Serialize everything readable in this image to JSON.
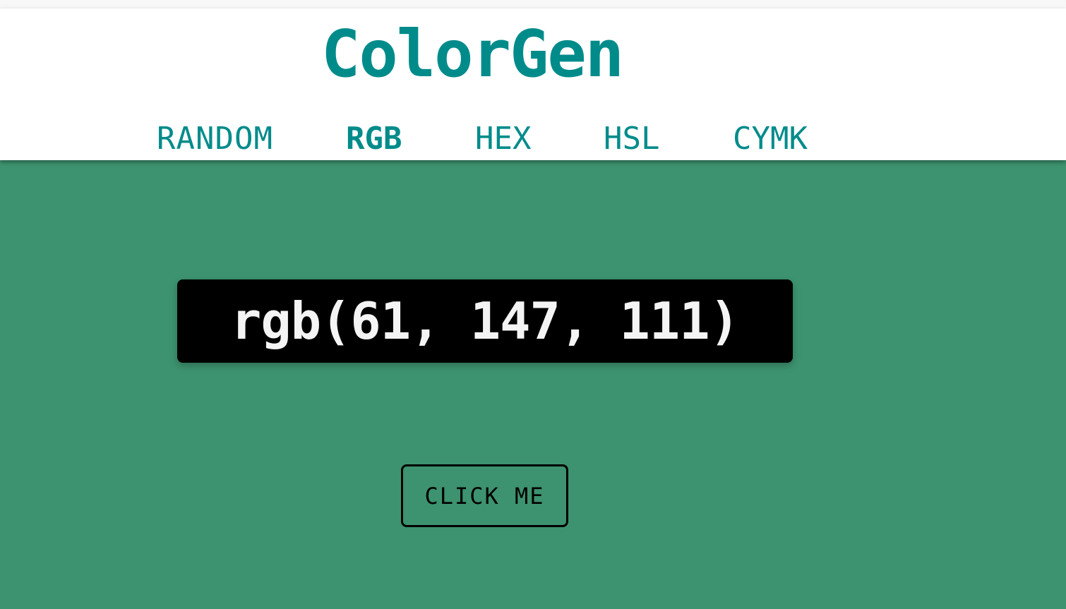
{
  "app": {
    "title": "ColorGen"
  },
  "nav": {
    "items": [
      {
        "label": "RANDOM",
        "active": false
      },
      {
        "label": "RGB",
        "active": true
      },
      {
        "label": "HEX",
        "active": false
      },
      {
        "label": "HSL",
        "active": false
      },
      {
        "label": "CYMK",
        "active": false
      }
    ]
  },
  "color": {
    "value": "rgb(61, 147, 111)",
    "background": "#3d936f"
  },
  "button": {
    "label": "CLICK ME"
  },
  "theme": {
    "accent": "#008b8b",
    "header_background": "#ffffff",
    "value_box_background": "#000000",
    "value_text": "#f4f4f4"
  }
}
